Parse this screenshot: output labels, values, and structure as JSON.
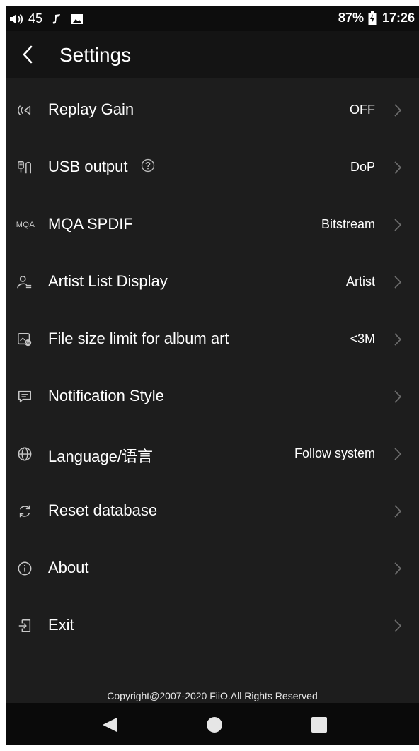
{
  "status_bar": {
    "volume": "45",
    "battery": "87%",
    "time": "17:26"
  },
  "header": {
    "title": "Settings"
  },
  "settings": [
    {
      "label": "Replay Gain",
      "value": "OFF",
      "icon": "replay-gain-icon"
    },
    {
      "label": "USB output",
      "value": "DoP",
      "icon": "usb-output-icon"
    },
    {
      "label": "MQA SPDIF",
      "value": "Bitstream",
      "icon": "mqa-icon",
      "icon_text": "MQA"
    },
    {
      "label": "Artist List Display",
      "value": "Artist",
      "icon": "artist-list-icon"
    },
    {
      "label": "File size limit for album art",
      "value": "<3M",
      "icon": "album-art-icon"
    },
    {
      "label": "Notification Style",
      "value": "",
      "icon": "notification-icon"
    },
    {
      "label": "Language/语言",
      "value": "Follow system",
      "icon": "globe-icon"
    },
    {
      "label": "Reset database",
      "value": "",
      "icon": "refresh-icon"
    },
    {
      "label": "About",
      "value": "",
      "icon": "info-icon"
    },
    {
      "label": "Exit",
      "value": "",
      "icon": "exit-icon"
    }
  ],
  "footer": {
    "copyright": "Copyright@2007-2020 FiiO.All Rights Reserved"
  },
  "colors": {
    "background": "#1d1d1d",
    "header": "#141414",
    "status_bar": "#0d0d0d",
    "text": "#ffffff",
    "chevron": "#6e6e6e",
    "icon": "#c8c8c8"
  }
}
